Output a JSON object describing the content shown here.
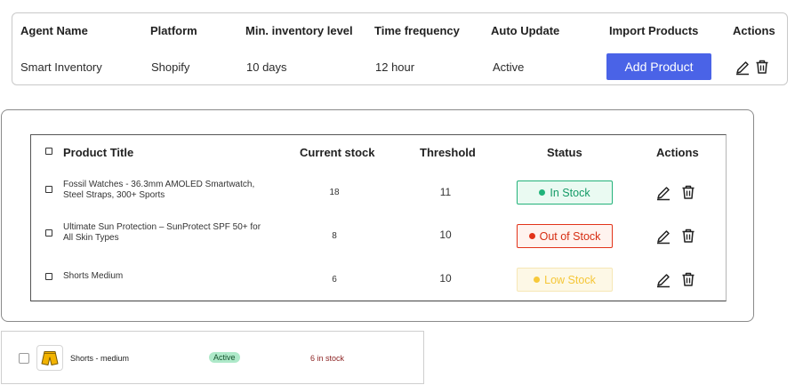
{
  "agent_table": {
    "headers": {
      "agent_name": "Agent Name",
      "platform": "Platform",
      "min_inventory": "Min. inventory level",
      "time_frequency": "Time frequency",
      "auto_update": "Auto Update",
      "import_products": "Import Products",
      "actions": "Actions"
    },
    "row": {
      "agent_name": "Smart Inventory",
      "platform": "Shopify",
      "min_inventory": "10 days",
      "time_frequency": "12 hour",
      "auto_update": "Active",
      "import_label": "Add Product"
    }
  },
  "products_table": {
    "headers": {
      "title": "Product Title",
      "current_stock": "Current stock",
      "threshold": "Threshold",
      "status": "Status",
      "actions": "Actions"
    },
    "rows": [
      {
        "title": "Fossil Watches - 36.3mm AMOLED Smartwatch, Steel Straps, 300+ Sports",
        "current_stock": "18",
        "threshold": "11",
        "status": "In Stock"
      },
      {
        "title": "Ultimate Sun Protection – SunProtect SPF 50+ for All Skin Types",
        "current_stock": "8",
        "threshold": "10",
        "status": "Out of Stock"
      },
      {
        "title": "Shorts Medium",
        "current_stock": "6",
        "threshold": "10",
        "status": "Low Stock"
      }
    ]
  },
  "list_item": {
    "title": "Shorts - medium",
    "status": "Active",
    "stock": "6 in stock"
  },
  "icons": {
    "edit": "pencil-edit-icon",
    "delete": "trash-icon",
    "thumbnail": "shorts-thumbnail-icon"
  },
  "colors": {
    "primary_button": "#4a63e7",
    "in_stock": "#1fb37a",
    "out_of_stock": "#e2331a",
    "low_stock": "#f7c93a",
    "active_badge": "#aee9c9"
  }
}
